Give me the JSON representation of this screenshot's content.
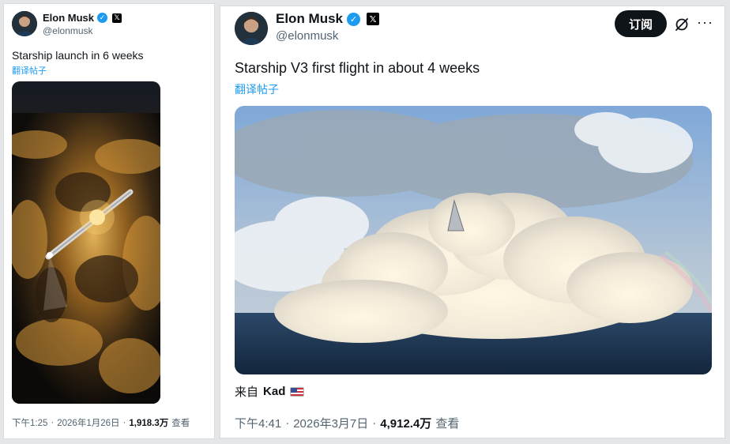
{
  "left_post": {
    "author": {
      "display_name": "Elon Musk",
      "handle": "@elonmusk"
    },
    "badges": {
      "verified": "✓",
      "x_logo": "𝕏"
    },
    "text": "Starship launch in 6 weeks",
    "translate_label": "翻译帖子",
    "media": {
      "icon": "rocket-launch-image"
    },
    "meta": {
      "time": "下午1:25",
      "separator": "·",
      "date": "2026年1月26日",
      "views": "1,918.3万",
      "views_suffix": "查看"
    }
  },
  "right_post": {
    "author": {
      "display_name": "Elon Musk",
      "handle": "@elonmusk"
    },
    "badges": {
      "verified": "✓",
      "x_logo": "𝕏"
    },
    "subscribe_label": "订阅",
    "more_label": "···",
    "text": "Starship V3 first flight in about 4 weeks",
    "translate_label": "翻译帖子",
    "media": {
      "icon": "ocean-launch-image"
    },
    "source": {
      "prefix": "来自",
      "name": "Kad"
    },
    "meta": {
      "time": "下午4:41",
      "separator": "·",
      "date": "2026年3月7日",
      "views": "4,912.4万",
      "views_suffix": "查看"
    }
  },
  "colors": {
    "accent": "#1d9bf0",
    "text": "#0f1419",
    "muted": "#536471",
    "button_bg": "#0f1419"
  }
}
